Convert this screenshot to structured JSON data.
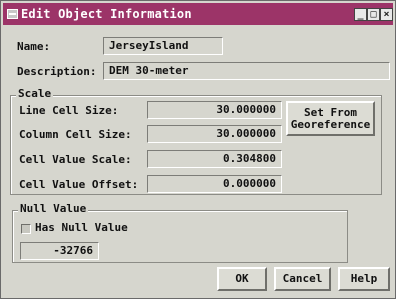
{
  "window": {
    "title": "Edit Object Information",
    "controls": {
      "minimize": "_",
      "maximize": "□",
      "close": "×"
    }
  },
  "form": {
    "name_label": "Name:",
    "name_value": "JerseyIsland",
    "description_label": "Description:",
    "description_value": "DEM 30-meter"
  },
  "scale": {
    "group_label": "Scale",
    "line_cell_size_label": "Line Cell Size:",
    "line_cell_size_value": "30.000000",
    "column_cell_size_label": "Column Cell Size:",
    "column_cell_size_value": "30.000000",
    "cell_value_scale_label": "Cell Value Scale:",
    "cell_value_scale_value": "0.304800",
    "cell_value_offset_label": "Cell Value Offset:",
    "cell_value_offset_value": "0.000000",
    "georef_button_label": "Set From\nGeoreference"
  },
  "null_value": {
    "group_label": "Null Value",
    "has_null_label": "Has Null Value",
    "has_null_checked": false,
    "value": "-32766"
  },
  "buttons": {
    "ok": "OK",
    "cancel": "Cancel",
    "help": "Help"
  },
  "colors": {
    "titlebar": "#9c3468",
    "dialog_bg": "#d6d6ce"
  }
}
